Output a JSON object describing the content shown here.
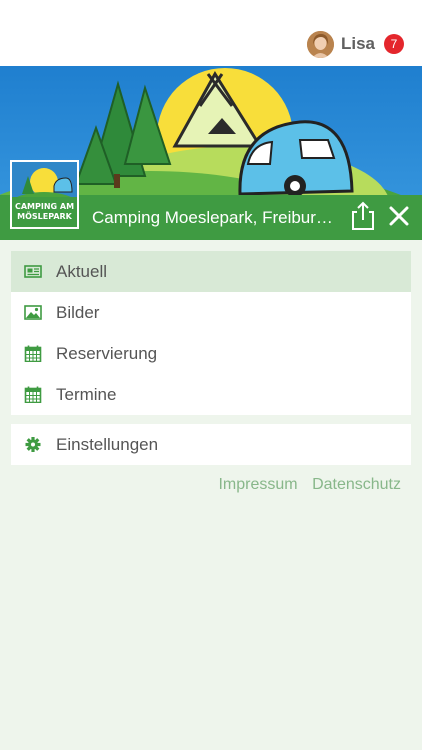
{
  "user": {
    "name": "Lisa",
    "notification_count": "7"
  },
  "header": {
    "title": "Camping Moeslepark, Freiburg im Breisgau"
  },
  "logo": {
    "text_line1": "CAMPING AM",
    "text_line2": "MÖSLEPARK"
  },
  "menu": {
    "items": [
      {
        "label": "Aktuell",
        "icon": "newspaper-icon"
      },
      {
        "label": "Bilder",
        "icon": "image-icon"
      },
      {
        "label": "Reservierung",
        "icon": "calendar-icon"
      },
      {
        "label": "Termine",
        "icon": "calendar-icon"
      }
    ],
    "settings": {
      "label": "Einstellungen",
      "icon": "gear-icon"
    }
  },
  "footer": {
    "impressum": "Impressum",
    "datenschutz": "Datenschutz"
  },
  "colors": {
    "brand_green": "#3f9b42",
    "active_bg": "#d8e9d6",
    "badge_red": "#e4262c",
    "link_green": "#88b78a"
  }
}
